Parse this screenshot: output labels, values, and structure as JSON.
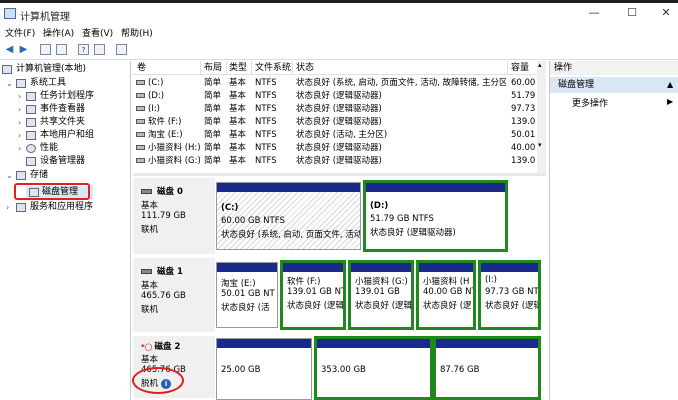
{
  "window": {
    "title": "计算机管理",
    "minimize": "—",
    "maximize": "☐",
    "close": "✕"
  },
  "menu": [
    "文件(F)",
    "操作(A)",
    "查看(V)",
    "帮助(H)"
  ],
  "tree": {
    "root": "计算机管理(本地)",
    "system_tools": "系统工具",
    "items": [
      "任务计划程序",
      "事件查看器",
      "共享文件夹",
      "本地用户和组",
      "性能",
      "设备管理器"
    ],
    "storage": "存储",
    "disk_mgmt": "磁盘管理",
    "services": "服务和应用程序"
  },
  "volume_table": {
    "headers": [
      "卷",
      "布局",
      "类型",
      "文件系统",
      "状态",
      "容量"
    ],
    "rows": [
      [
        "(C:)",
        "简单",
        "基本",
        "NTFS",
        "状态良好 (系统, 启动, 页面文件, 活动, 故障转储, 主分区)",
        "60.00"
      ],
      [
        "(D:)",
        "简单",
        "基本",
        "NTFS",
        "状态良好 (逻辑驱动器)",
        "51.79"
      ],
      [
        "(I:)",
        "简单",
        "基本",
        "NTFS",
        "状态良好 (逻辑驱动器)",
        "97.73"
      ],
      [
        "软件 (F:)",
        "简单",
        "基本",
        "NTFS",
        "状态良好 (逻辑驱动器)",
        "139.0"
      ],
      [
        "淘宝 (E:)",
        "简单",
        "基本",
        "NTFS",
        "状态良好 (活动, 主分区)",
        "50.01"
      ],
      [
        "小猫资料 (H:)",
        "简单",
        "基本",
        "NTFS",
        "状态良好 (逻辑驱动器)",
        "40.00"
      ],
      [
        "小猫资料 (G:)",
        "简单",
        "基本",
        "NTFS",
        "状态良好 (逻辑驱动器)",
        "139.0"
      ]
    ]
  },
  "disks": [
    {
      "name": "磁盘 0",
      "type": "基本",
      "size": "111.79 GB",
      "status": "联机",
      "partitions": [
        {
          "name": "(C:)",
          "size": "60.00 GB NTFS",
          "status": "状态良好 (系统, 启动, 页面文件, 活动"
        },
        {
          "name": "(D:)",
          "size": "51.79 GB NTFS",
          "status": "状态良好 (逻辑驱动器)"
        }
      ]
    },
    {
      "name": "磁盘 1",
      "type": "基本",
      "size": "465.76 GB",
      "status": "联机",
      "partitions": [
        {
          "name": "淘宝 (E:)",
          "size": "50.01 GB NT",
          "status": "状态良好 (活"
        },
        {
          "name": "软件 (F:)",
          "size": "139.01 GB NT",
          "status": "状态良好 (逻辑"
        },
        {
          "name": "小猫资料 (G:)",
          "size": "139.01 GB",
          "status": "状态良好 (逻辑"
        },
        {
          "name": "小猫资料 (H",
          "size": "40.00 GB NT",
          "status": "状态良好 (逻"
        },
        {
          "name": "(I:)",
          "size": "97.73 GB NT",
          "status": "状态良好 (逻辑"
        }
      ]
    },
    {
      "name": "磁盘 2",
      "type": "基本",
      "size": "465.76 GB",
      "status": "脱机",
      "partitions": [
        {
          "size": "25.00 GB"
        },
        {
          "size": "353.00 GB"
        },
        {
          "size": "87.76 GB"
        }
      ]
    }
  ],
  "actions": {
    "header": "操作",
    "section": "磁盘管理",
    "more": "更多操作"
  }
}
